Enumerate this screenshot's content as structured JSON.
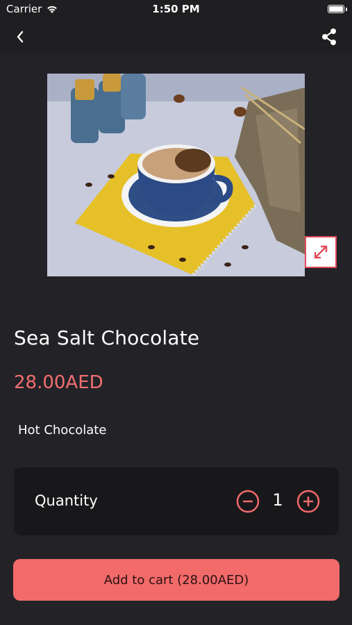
{
  "status_bar": {
    "carrier": "Carrier",
    "time": "1:50 PM"
  },
  "nav": {
    "back_icon": "chevron-left-icon",
    "share_icon": "share-icon"
  },
  "product": {
    "name": "Sea Salt Chocolate",
    "price": "28.00AED",
    "category": "Hot Chocolate",
    "expand_icon": "expand-arrows-icon"
  },
  "quantity": {
    "label": "Quantity",
    "value": "1"
  },
  "cart_button": {
    "label": "Add to cart (28.00AED)"
  },
  "colors": {
    "accent": "#f26a6a",
    "background": "#232327",
    "card": "#18181b"
  }
}
